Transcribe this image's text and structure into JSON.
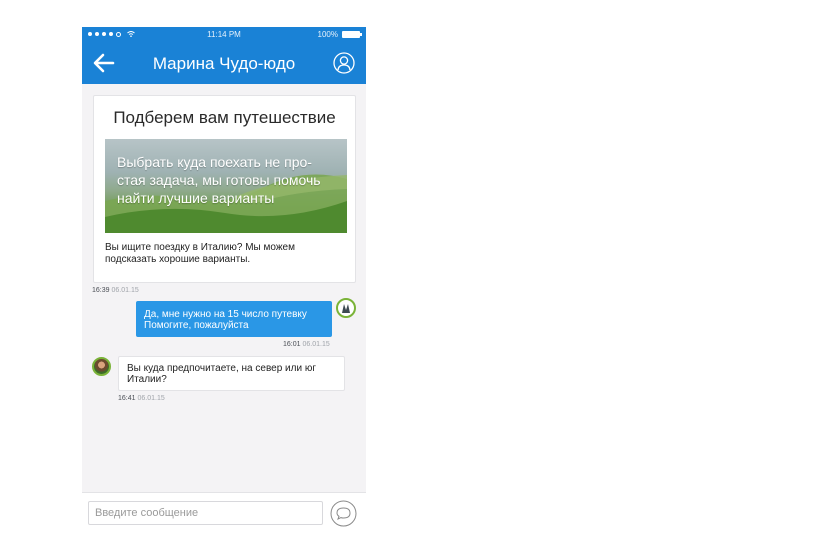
{
  "status_bar": {
    "time": "11:14 PM",
    "battery": "100%"
  },
  "header": {
    "title": "Марина Чудо-юдо"
  },
  "card": {
    "title": "Подберем вам путешествие",
    "banner_text": "Выбрать куда поехать не про-стая задача, мы готовы помочь найти лучшие варианты",
    "body": "Вы ищите поездку в Италию? Мы можем подсказать хорошие варианты.",
    "time": "16:39",
    "date": "06.01.15"
  },
  "messages": [
    {
      "direction": "out",
      "text": "Да, мне нужно на 15 число путевку Помогите, пожалуйста",
      "time": "16:01",
      "date": "06.01.15"
    },
    {
      "direction": "in",
      "text": "Вы куда предпочитаете, на север или юг Италии?",
      "time": "16:41",
      "date": "06.01.15"
    }
  ],
  "composer": {
    "placeholder": "Введите сообщение"
  },
  "colors": {
    "accent": "#1a82d6",
    "bubble_out": "#2a97e6",
    "avatar_ring": "#7ab338"
  },
  "icons": {
    "back": "arrow-left-icon",
    "profile": "user-circle-icon",
    "send": "chat-bubble-icon",
    "wifi": "wifi-icon",
    "battery": "battery-icon"
  }
}
